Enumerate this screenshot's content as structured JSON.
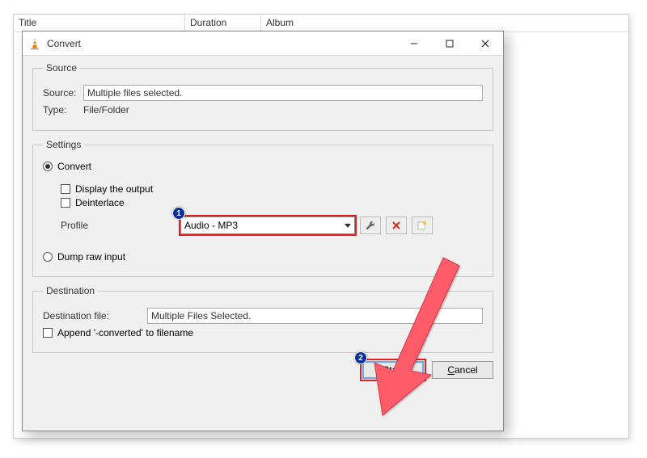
{
  "background": {
    "columns": {
      "title": "Title",
      "duration": "Duration",
      "album": "Album"
    }
  },
  "dialog": {
    "title": "Convert",
    "source": {
      "legend": "Source",
      "sourceLabel": "Source:",
      "sourceValue": "Multiple files selected.",
      "typeLabel": "Type:",
      "typeValue": "File/Folder"
    },
    "settings": {
      "legend": "Settings",
      "convertLabel": "Convert",
      "displayOutputLabel": "Display the output",
      "deinterlaceLabel": "Deinterlace",
      "profileLabel": "Profile",
      "profileValue": "Audio - MP3",
      "dumpRawLabel": "Dump raw input"
    },
    "destination": {
      "legend": "Destination",
      "fileLabel": "Destination file:",
      "fileValue": "Multiple Files Selected.",
      "appendLabel": "Append '-converted' to filename"
    },
    "buttons": {
      "start": "Start",
      "cancel": "Cancel"
    }
  },
  "annotations": {
    "badge1": "1",
    "badge2": "2"
  }
}
